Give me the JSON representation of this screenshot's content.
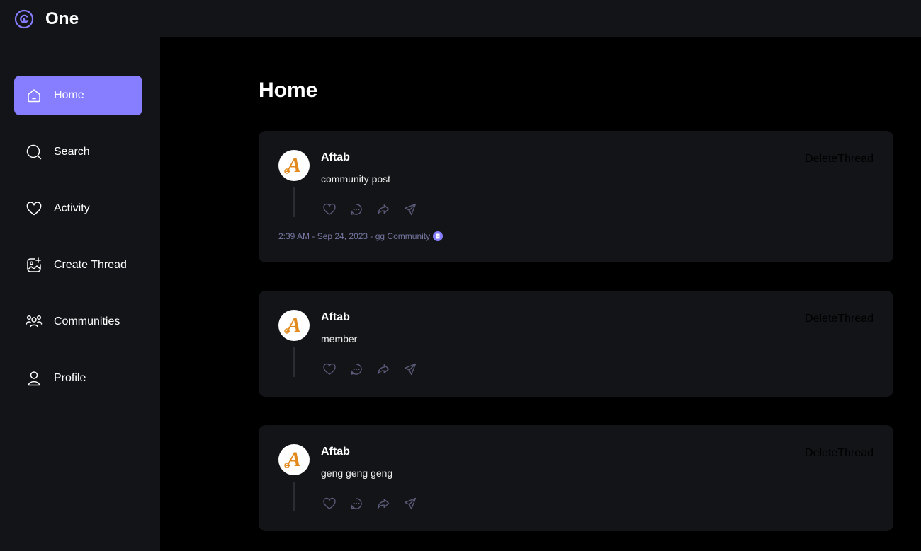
{
  "app": {
    "brand": "One"
  },
  "sidebar": {
    "items": [
      {
        "label": "Home",
        "icon": "home-icon",
        "active": true
      },
      {
        "label": "Search",
        "icon": "search-icon",
        "active": false
      },
      {
        "label": "Activity",
        "icon": "heart-icon",
        "active": false
      },
      {
        "label": "Create Thread",
        "icon": "image-plus-icon",
        "active": false
      },
      {
        "label": "Communities",
        "icon": "users-icon",
        "active": false
      },
      {
        "label": "Profile",
        "icon": "user-icon",
        "active": false
      }
    ]
  },
  "main": {
    "title": "Home",
    "threads": [
      {
        "author": "Aftab",
        "content": "community post",
        "delete_label": "DeleteThread",
        "meta": "2:39 AM - Sep 24, 2023 - gg Community"
      },
      {
        "author": "Aftab",
        "content": "member",
        "delete_label": "DeleteThread"
      },
      {
        "author": "Aftab",
        "content": "geng geng geng",
        "delete_label": "DeleteThread"
      }
    ]
  },
  "colors": {
    "accent": "#877EFF",
    "panel": "#121417",
    "background": "#000000",
    "muted": "#7878A3"
  }
}
